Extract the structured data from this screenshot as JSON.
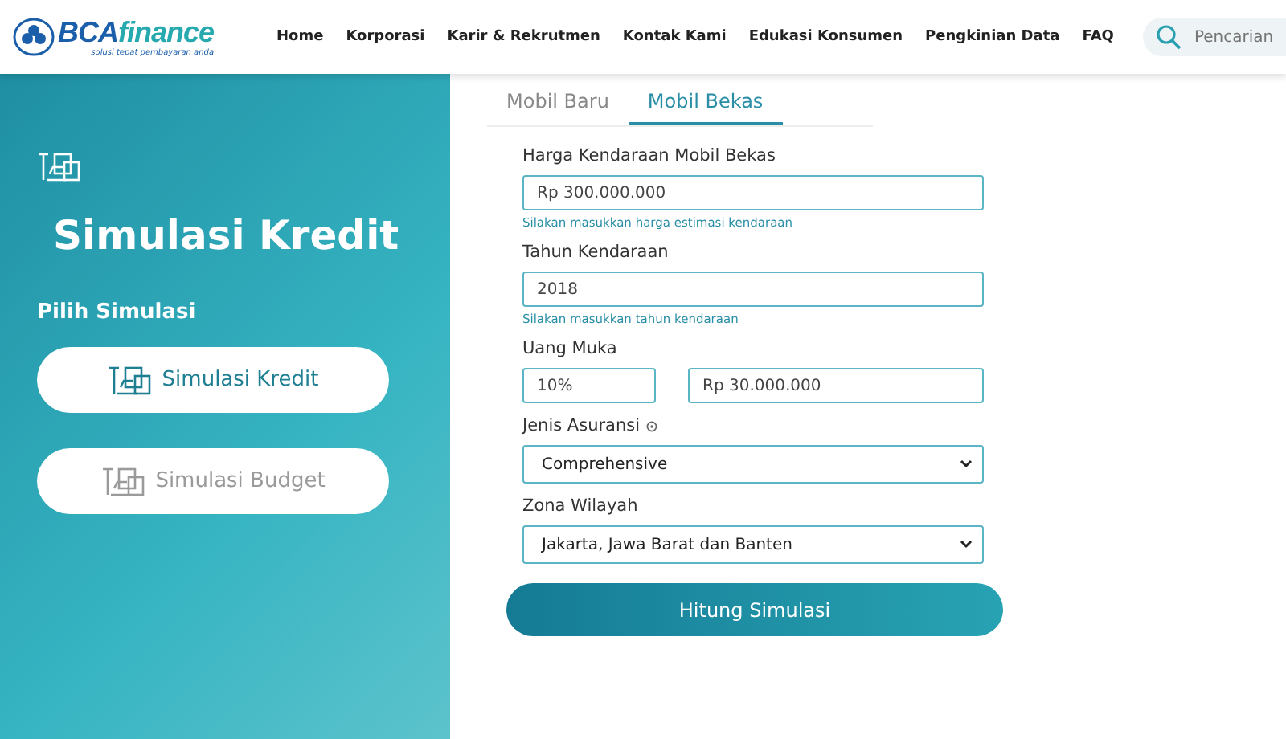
{
  "header": {
    "logo": {
      "brand_main": "BCA",
      "brand_accent": "finance",
      "tagline": "solusi tepat pembayaran anda"
    },
    "nav": [
      "Home",
      "Korporasi",
      "Karir & Rekrutmen",
      "Kontak Kami",
      "Edukasi Konsumen",
      "Pengkinian Data",
      "FAQ"
    ],
    "search": {
      "placeholder": "Pencarian"
    }
  },
  "sidebar": {
    "title": "Simulasi Kredit",
    "subtitle": "Pilih Simulasi",
    "options": [
      {
        "label": "Simulasi Kredit",
        "selected": true
      },
      {
        "label": "Simulasi Budget",
        "selected": false
      }
    ]
  },
  "tabs": [
    {
      "label": "Mobil Baru",
      "selected": false
    },
    {
      "label": "Mobil Bekas",
      "selected": true
    }
  ],
  "fields": [
    {
      "kind": "text",
      "label": "Harga Kendaraan Mobil Bekas",
      "value": "Rp 300.000.000",
      "hint": "Silakan masukkan harga estimasi kendaraan"
    },
    {
      "kind": "text",
      "label": "Tahun Kendaraan",
      "value": "2018",
      "hint": "Silakan masukkan tahun kendaraan"
    },
    {
      "kind": "split",
      "label": "Uang Muka",
      "value": "10%",
      "value2": "Rp 30.000.000"
    },
    {
      "kind": "select",
      "label": "Jenis Asuransi",
      "info": true,
      "value": "Comprehensive"
    },
    {
      "kind": "select",
      "label": "Zona Wilayah",
      "value": "Jakarta, Jawa Barat dan Banten"
    }
  ],
  "submit": "Hitung Simulasi"
}
